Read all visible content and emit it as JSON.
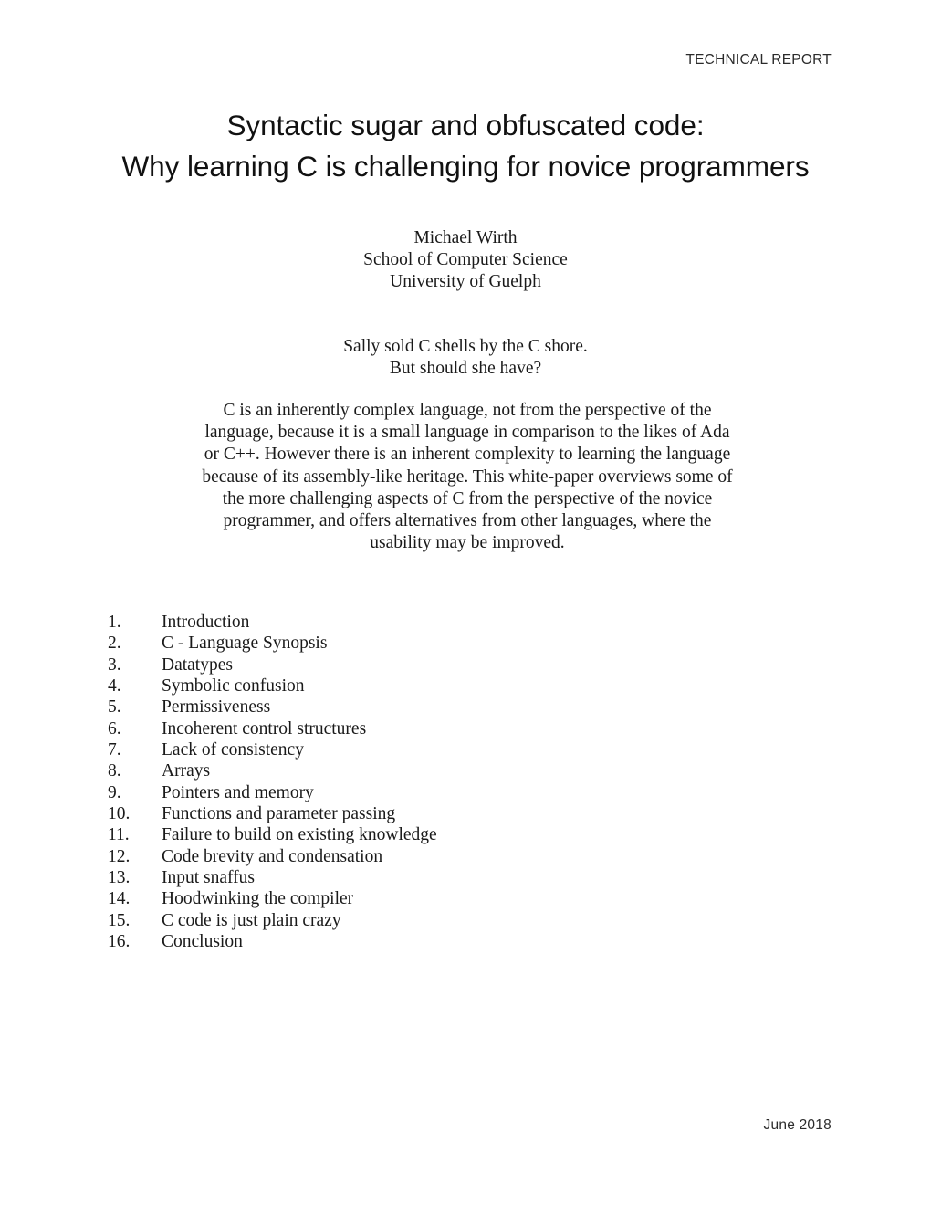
{
  "document": {
    "running_header": "TECHNICAL REPORT",
    "running_footer": "June 2018",
    "title": {
      "line1": "Syntactic sugar and obfuscated code:",
      "line2": "Why learning C is challenging for novice programmers"
    },
    "author": {
      "name": "Michael Wirth",
      "department": "School of Computer Science",
      "institution": "University of Guelph"
    },
    "epigraph": {
      "line1": "Sally sold C shells by the C shore.",
      "line2": "But should she have?"
    },
    "abstract": {
      "lines": [
        "C is an inherently complex language, not from the perspective of the",
        "language, because it is a small language in comparison to the likes of Ada",
        "or C++. However there is an inherent complexity to learning the language",
        "because of its assembly-like heritage. This white-paper overviews some of",
        "the more challenging aspects of C from the perspective of the novice",
        "programmer, and offers alternatives from other languages, where the",
        "usability may be improved."
      ]
    },
    "contents": [
      {
        "number": "1.",
        "label": "Introduction"
      },
      {
        "number": "2.",
        "label": "C - Language Synopsis"
      },
      {
        "number": "3.",
        "label": "Datatypes"
      },
      {
        "number": "4.",
        "label": "Symbolic confusion"
      },
      {
        "number": "5.",
        "label": "Permissiveness"
      },
      {
        "number": "6.",
        "label": "Incoherent control structures"
      },
      {
        "number": "7.",
        "label": "Lack of consistency"
      },
      {
        "number": "8.",
        "label": "Arrays"
      },
      {
        "number": "9.",
        "label": "Pointers and memory"
      },
      {
        "number": "10.",
        "label": "Functions and parameter passing"
      },
      {
        "number": "11.",
        "label": "Failure to build on existing knowledge"
      },
      {
        "number": "12.",
        "label": "Code brevity and condensation"
      },
      {
        "number": "13.",
        "label": "Input snaffus"
      },
      {
        "number": "14.",
        "label": "Hoodwinking the compiler"
      },
      {
        "number": "15.",
        "label": "C code is just plain crazy"
      },
      {
        "number": "16.",
        "label": "Conclusion"
      }
    ],
    "colors": {
      "page_background": "#ffffff",
      "body_text": "#1a1a1a",
      "header_text": "#2b2b2b",
      "title_text": "#111111"
    }
  }
}
